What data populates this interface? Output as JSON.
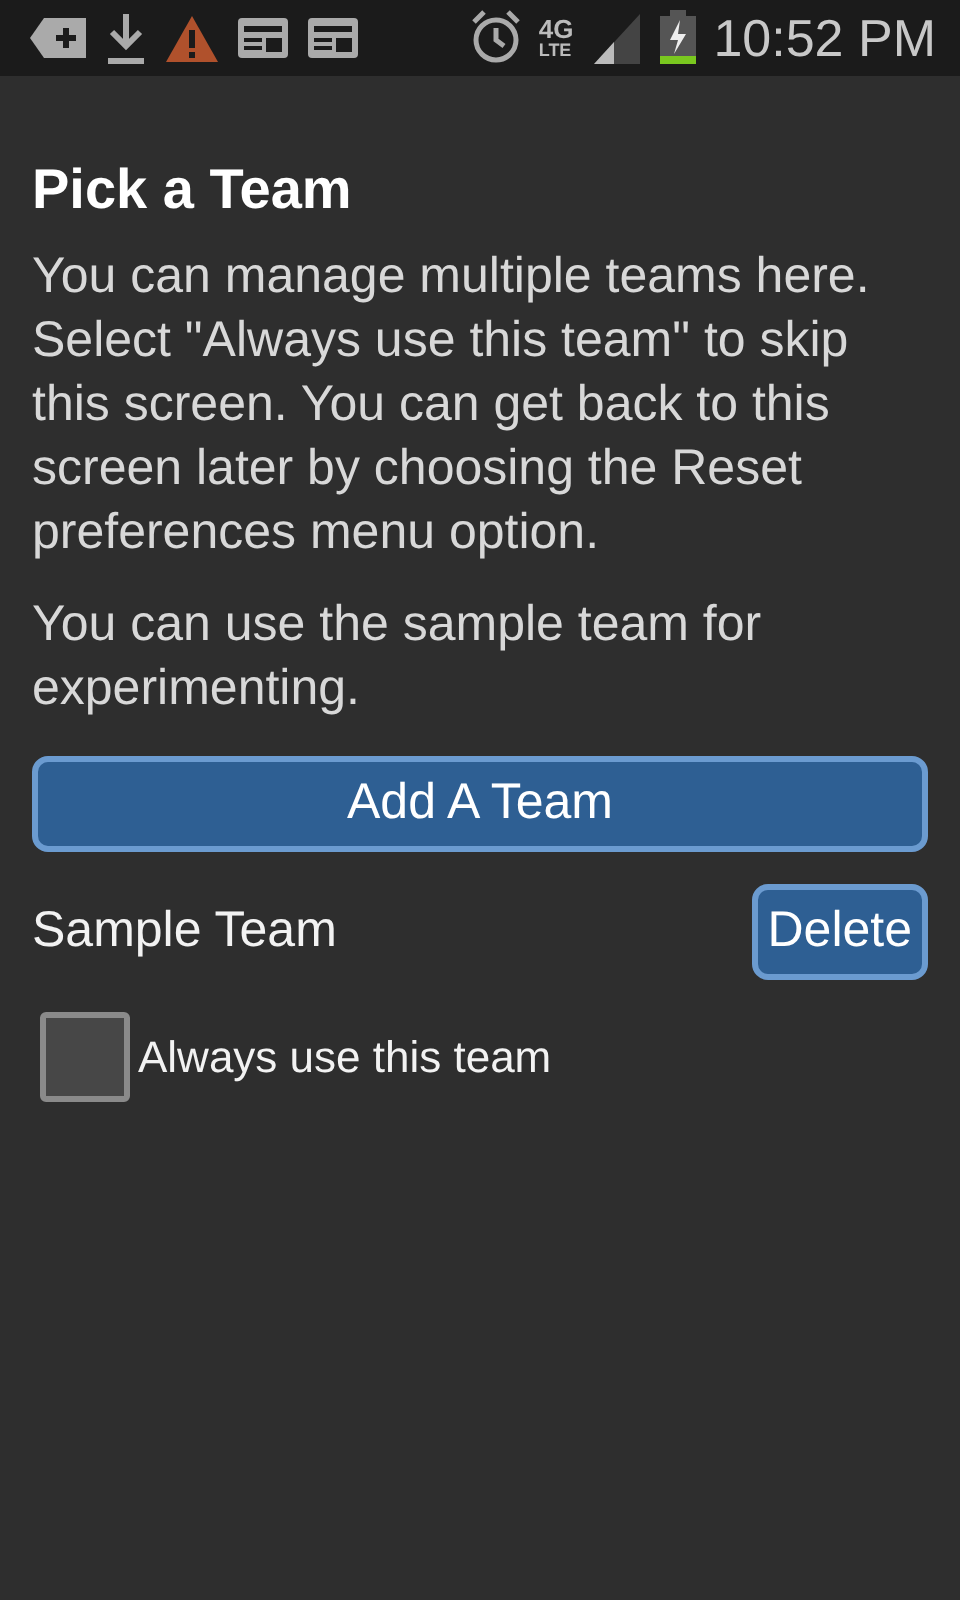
{
  "status_bar": {
    "time": "10:52 PM",
    "network": "4G",
    "network_sub": "LTE",
    "battery_charging": true
  },
  "title": "Pick a Team",
  "paragraphs": [
    "You can manage multiple teams here. Select \"Always use this team\" to skip this screen. You can get back to this screen later by choosing the Reset preferences menu option.",
    "You can use the sample team for experimenting."
  ],
  "add_button": "Add A Team",
  "teams": [
    {
      "name": "Sample Team",
      "delete_label": "Delete"
    }
  ],
  "always_use": {
    "label": "Always use this team",
    "checked": false
  }
}
